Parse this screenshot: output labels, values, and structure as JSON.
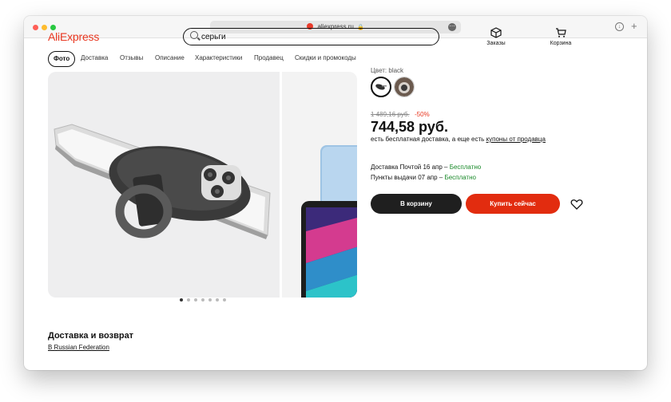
{
  "browser": {
    "url": "aliexpress.ru"
  },
  "header": {
    "logo": "AliExpress",
    "search_value": "серьги",
    "orders_label": "Заказы",
    "cart_label": "Корзина"
  },
  "tabs": [
    "Фото",
    "Доставка",
    "Отзывы",
    "Описание",
    "Характеристики",
    "Продавец",
    "Скидки и промокоды"
  ],
  "gallery": {
    "page_count": 7,
    "active_index": 0
  },
  "product": {
    "color_label": "Цвет: black",
    "old_price": "1 489,16 руб.",
    "discount": "-50%",
    "price": "744,58 руб.",
    "delivery_note_prefix": "есть бесплатная доставка, а еще есть ",
    "delivery_note_link": "купоны от продавца",
    "shipping": [
      {
        "text": "Доставка Почтой 16 апр – ",
        "free": "Бесплатно"
      },
      {
        "text": "Пункты выдачи 07 апр – ",
        "free": "Бесплатно"
      }
    ],
    "add_to_cart": "В корзину",
    "buy_now": "Купить сейчас"
  },
  "delivery_section": {
    "title": "Доставка и возврат",
    "region": "В Russian Federation"
  },
  "colors": {
    "brand": "#e8361f",
    "buy_button": "#e22c0f",
    "cart_button": "#1f1f1f",
    "free_text": "#1a8a2a"
  }
}
